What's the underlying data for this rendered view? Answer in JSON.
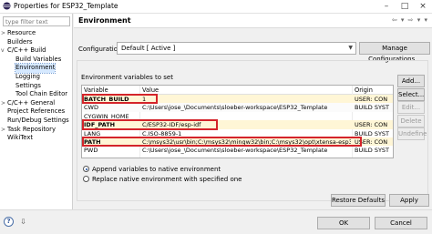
{
  "window": {
    "title": "Properties for ESP32_Template",
    "minimize_glyph": "–",
    "maximize_glyph": "□",
    "close_glyph": "×"
  },
  "sidebar": {
    "filter_placeholder": "type filter text",
    "items": [
      {
        "label": "Resource",
        "twisty": ">",
        "indent": 1
      },
      {
        "label": "Builders",
        "twisty": "",
        "indent": 1
      },
      {
        "label": "C/C++ Build",
        "twisty": "v",
        "indent": 1
      },
      {
        "label": "Build Variables",
        "twisty": "",
        "indent": 2
      },
      {
        "label": "Environment",
        "twisty": "",
        "indent": 2,
        "selected": true
      },
      {
        "label": "Logging",
        "twisty": "",
        "indent": 2
      },
      {
        "label": "Settings",
        "twisty": "",
        "indent": 2
      },
      {
        "label": "Tool Chain Editor",
        "twisty": "",
        "indent": 2
      },
      {
        "label": "C/C++ General",
        "twisty": ">",
        "indent": 1
      },
      {
        "label": "Project References",
        "twisty": "",
        "indent": 1
      },
      {
        "label": "Run/Debug Settings",
        "twisty": "",
        "indent": 1
      },
      {
        "label": "Task Repository",
        "twisty": ">",
        "indent": 1
      },
      {
        "label": "WikiText",
        "twisty": "",
        "indent": 1
      }
    ]
  },
  "main": {
    "heading": "Environment",
    "nav_icons": "⇦ ▾ ⇨ ▾ ▾",
    "configuration_label": "Configuration:",
    "configuration_value": "Default  [ Active ]",
    "manage_button": "Manage Configurations...",
    "vars_label": "Environment variables to set",
    "table": {
      "headers": [
        "Variable",
        "Value",
        "Origin"
      ],
      "rows": [
        {
          "variable": "BATCH_BUILD",
          "value": "1",
          "origin": "USER: CON",
          "bold": true,
          "highlight": true
        },
        {
          "variable": "CWD",
          "value": "C:\\Users\\jose_\\Documents\\sloeber-workspace\\ESP32_Template",
          "origin": "BUILD SYST"
        },
        {
          "variable": "CYGWIN_HOME",
          "value": "",
          "origin": ""
        },
        {
          "variable": "IDF_PATH",
          "value": "C/ESP32-IDF/esp-idf",
          "origin": "USER: CON",
          "bold": true,
          "highlight": true
        },
        {
          "variable": "LANG",
          "value": "C.ISO-8859-1",
          "origin": "BUILD SYST"
        },
        {
          "variable": "PATH",
          "value": "C:\\msys32\\usr\\bin;C:\\msys32\\mingw32\\bin;C:\\msys32\\opt\\xtensa-esp32-elf\\bin",
          "origin": "USER: CON",
          "bold": true,
          "highlight": true
        },
        {
          "variable": "PWD",
          "value": "C:\\Users\\jose_\\Documents\\sloeber-workspace\\ESP32_Template",
          "origin": "BUILD SYST"
        }
      ]
    },
    "side_buttons": [
      {
        "label": "Add...",
        "enabled": true
      },
      {
        "label": "Select...",
        "enabled": true
      },
      {
        "label": "Edit...",
        "enabled": false
      },
      {
        "label": "Delete",
        "enabled": false
      },
      {
        "label": "Undefine",
        "enabled": false
      }
    ],
    "radio_append": "Append variables to native environment",
    "radio_replace": "Replace native environment with specified one",
    "restore_button": "Restore Defaults",
    "apply_button": "Apply"
  },
  "footer": {
    "help_glyph": "?",
    "export_glyph": "⇩",
    "ok_button": "OK",
    "cancel_button": "Cancel"
  },
  "colors": {
    "highlight_border": "#d4242a",
    "selection": "#d6e9ff"
  }
}
